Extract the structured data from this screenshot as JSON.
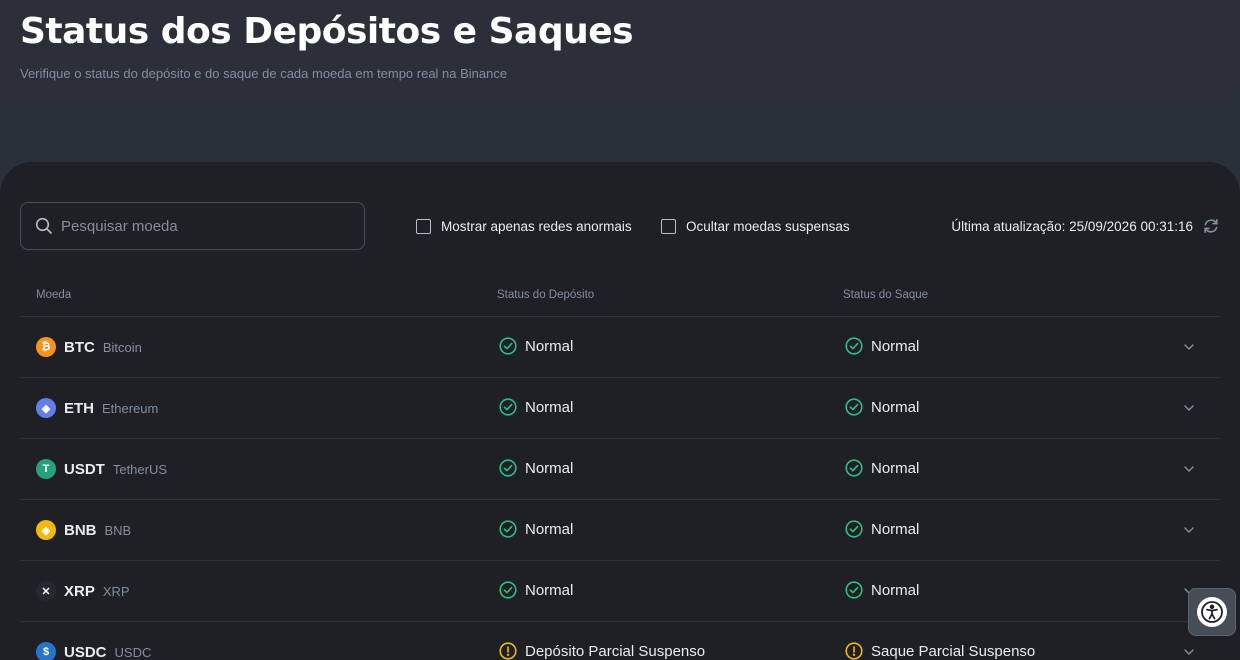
{
  "header": {
    "title": "Status dos Depósitos e Saques",
    "subtitle": "Verifique o status do depósito e do saque de cada moeda em tempo real na Binance"
  },
  "toolbar": {
    "search_placeholder": "Pesquisar moeda",
    "search_value": "",
    "filter_abnormal_label": "Mostrar apenas redes anormais",
    "filter_abnormal_checked": false,
    "filter_suspended_label": "Ocultar moedas suspensas",
    "filter_suspended_checked": false,
    "last_update": "Última atualização: 25/09/2026 00:31:16"
  },
  "table": {
    "columns": [
      "Moeda",
      "Status do Depósito",
      "Status do Saque"
    ],
    "rows": [
      {
        "symbol": "BTC",
        "name": "Bitcoin",
        "icon": "bitcoin-icon",
        "icon_color": "#f7931a",
        "deposit": "Normal",
        "withdraw": "Normal",
        "deposit_state": "ok",
        "withdraw_state": "ok"
      },
      {
        "symbol": "ETH",
        "name": "Ethereum",
        "icon": "ethereum-icon",
        "icon_color": "#627eea",
        "deposit": "Normal",
        "withdraw": "Normal",
        "deposit_state": "ok",
        "withdraw_state": "ok"
      },
      {
        "symbol": "USDT",
        "name": "TetherUS",
        "icon": "tether-icon",
        "icon_color": "#26a17b",
        "deposit": "Normal",
        "withdraw": "Normal",
        "deposit_state": "ok",
        "withdraw_state": "ok"
      },
      {
        "symbol": "BNB",
        "name": "BNB",
        "icon": "bnb-icon",
        "icon_color": "#f0b90b",
        "deposit": "Normal",
        "withdraw": "Normal",
        "deposit_state": "ok",
        "withdraw_state": "ok"
      },
      {
        "symbol": "XRP",
        "name": "XRP",
        "icon": "xrp-icon",
        "icon_color": "#23292f",
        "deposit": "Normal",
        "withdraw": "Normal",
        "deposit_state": "ok",
        "withdraw_state": "ok"
      },
      {
        "symbol": "USDC",
        "name": "USDC",
        "icon": "usdc-icon",
        "icon_color": "#2775ca",
        "deposit": "Depósito Parcial Suspenso",
        "withdraw": "Saque Parcial Suspenso",
        "deposit_state": "warn",
        "withdraw_state": "warn"
      }
    ]
  },
  "colors": {
    "ok": "#2ebd85",
    "warn": "#f0b90b"
  }
}
